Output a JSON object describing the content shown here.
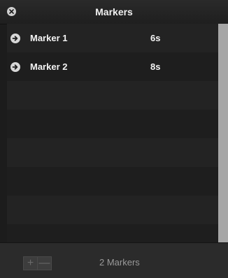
{
  "window": {
    "title": "Markers"
  },
  "markers": [
    {
      "name": "Marker 1",
      "time": "6s"
    },
    {
      "name": "Marker 2",
      "time": "8s"
    }
  ],
  "footer": {
    "add_label": "+",
    "remove_label": "—",
    "count_text": "2 Markers"
  },
  "icons": {
    "close": "close-icon",
    "go": "arrow-right-icon"
  },
  "colors": {
    "background": "#1c1c1c",
    "text": "#f3f3f3",
    "scrollbar": "#a6a6a6"
  }
}
